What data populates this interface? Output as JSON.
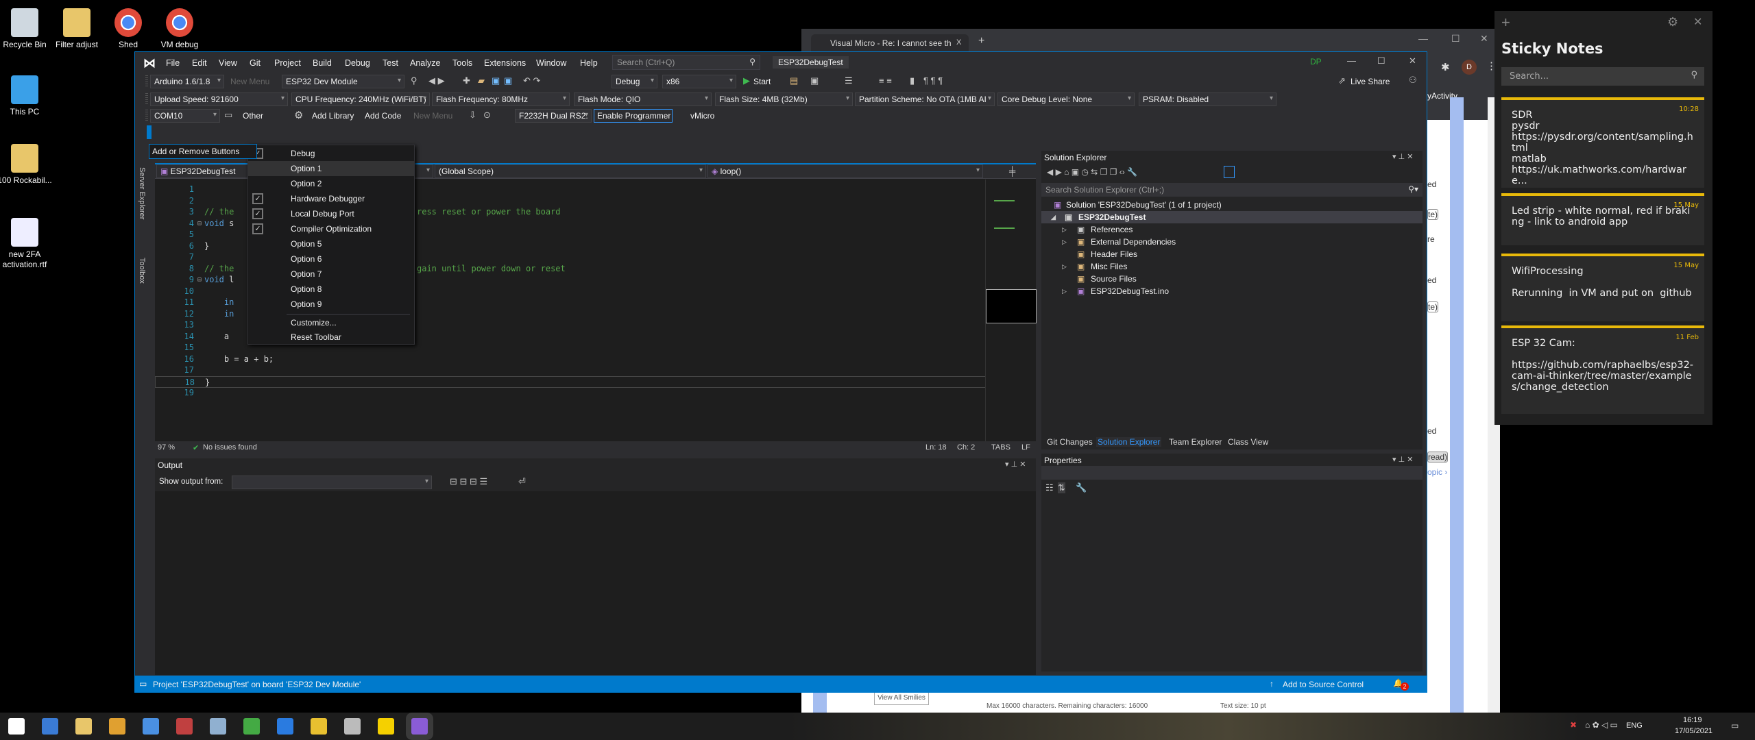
{
  "desktop": {
    "icons": [
      {
        "label": "Recycle Bin",
        "icon": "recycle-bin-icon"
      },
      {
        "label": "Filter adjust",
        "icon": "folder-icon"
      },
      {
        "label": "Shed",
        "icon": "chrome-icon"
      },
      {
        "label": "VM debug",
        "icon": "chrome-icon"
      },
      {
        "label": "This PC",
        "icon": "computer-icon"
      },
      {
        "label": "100 Rockabil...",
        "icon": "folder-icon"
      },
      {
        "label": "new 2FA activation.rtf",
        "icon": "document-icon"
      }
    ]
  },
  "browser": {
    "tab_title": "Visual Micro - Re: I cannot see th",
    "close": "X",
    "new_tab": "+",
    "avatar": "D",
    "page_fragments": [
      "yActivity",
      "ed",
      "te)",
      "re",
      "ed",
      "te)",
      "ed",
      "read)",
      "opic ›"
    ],
    "view_smilies": "View All Smilies",
    "max_chars": "Max 16000 characters. Remaining characters: 16000",
    "text_size": "Text size: 10 pt"
  },
  "vs": {
    "title": "ESP32DebugTest",
    "user_badge": "DP",
    "menu": [
      "File",
      "Edit",
      "View",
      "Git",
      "Project",
      "Build",
      "Debug",
      "Test",
      "Analyze",
      "Tools",
      "Extensions",
      "Window",
      "Help"
    ],
    "search_placeholder": "Search (Ctrl+Q)",
    "toolbar1": {
      "platform": "Arduino 1.6/1.8",
      "new_menu": "New Menu",
      "board": "ESP32 Dev Module",
      "config": "Debug",
      "arch": "x86",
      "start": "Start",
      "live_share": "Live Share"
    },
    "toolbar2": {
      "upload_speed": "Upload Speed: 921600",
      "cpu_freq": "CPU Frequency: 240MHz (WiFi/BT)",
      "flash_freq": "Flash Frequency: 80MHz",
      "flash_mode": "Flash Mode: QIO",
      "flash_size": "Flash Size: 4MB (32Mb)",
      "partition": "Partition Scheme: No OTA (1MB AI",
      "core_debug": "Core Debug Level: None",
      "psram": "PSRAM: Disabled"
    },
    "toolbar3": {
      "port": "COM10",
      "other": "Other",
      "add_library": "Add Library",
      "add_code": "Add Code",
      "new_menu": "New Menu",
      "programmer": "F2232H Dual RS2:",
      "enable_programmer": "Enable Programmer",
      "vmicro": "vMicro"
    },
    "add_remove_buttons": "Add or Remove Buttons",
    "dropdown": {
      "items": [
        {
          "label": "Debug",
          "checked": true
        },
        {
          "label": "Option 1",
          "checked": false,
          "hover": true
        },
        {
          "label": "Option 2",
          "checked": false
        },
        {
          "label": "Hardware Debugger",
          "checked": true
        },
        {
          "label": "Local Debug Port",
          "checked": true
        },
        {
          "label": "Compiler Optimization",
          "checked": true
        },
        {
          "label": "Option 5",
          "checked": false
        },
        {
          "label": "Option 6",
          "checked": false
        },
        {
          "label": "Option 7",
          "checked": false
        },
        {
          "label": "Option 8",
          "checked": false
        },
        {
          "label": "Option 9",
          "checked": false
        }
      ],
      "customize": "Customize...",
      "reset": "Reset Toolbar"
    },
    "side_tabs": [
      "Server Explorer",
      "Toolbox"
    ],
    "editor": {
      "nav": {
        "project": "ESP32DebugTest",
        "scope": "(Global Scope)",
        "member": "loop()"
      },
      "lines": [
        {
          "n": "1",
          "parts": []
        },
        {
          "n": "2",
          "parts": []
        },
        {
          "n": "3",
          "parts": [
            {
              "t": "// the",
              "c": "cc"
            }
          ],
          "tail": "ress reset or power the board"
        },
        {
          "n": "4",
          "parts": [
            {
              "t": "void",
              "c": "ck"
            },
            {
              "t": " s",
              "c": "cp"
            }
          ],
          "fold": true
        },
        {
          "n": "5",
          "parts": []
        },
        {
          "n": "6",
          "parts": [
            {
              "t": "}",
              "c": "cp"
            }
          ]
        },
        {
          "n": "7",
          "parts": []
        },
        {
          "n": "8",
          "parts": [
            {
              "t": "// the",
              "c": "cc"
            }
          ],
          "tail": "gain until power down or reset"
        },
        {
          "n": "9",
          "parts": [
            {
              "t": "void",
              "c": "ck"
            },
            {
              "t": " l",
              "c": "cp"
            }
          ],
          "fold": true
        },
        {
          "n": "10",
          "parts": []
        },
        {
          "n": "11",
          "parts": [
            {
              "t": "    in",
              "c": "ck"
            }
          ]
        },
        {
          "n": "12",
          "parts": [
            {
              "t": "    in",
              "c": "ck"
            }
          ]
        },
        {
          "n": "13",
          "parts": []
        },
        {
          "n": "14",
          "parts": [
            {
              "t": "    a",
              "c": "cp"
            }
          ]
        },
        {
          "n": "15",
          "parts": []
        },
        {
          "n": "16",
          "parts": [
            {
              "t": "    b = a + b;",
              "c": "cp"
            }
          ]
        },
        {
          "n": "17",
          "parts": []
        },
        {
          "n": "18",
          "parts": [
            {
              "t": "}",
              "c": "cp"
            }
          ],
          "current": true
        },
        {
          "n": "19",
          "parts": []
        }
      ],
      "zoom": "97 %",
      "issues": "No issues found",
      "ln": "Ln: 18",
      "ch": "Ch: 2",
      "tabs": "TABS",
      "eol": "LF"
    },
    "output": {
      "title": "Output",
      "show_from": "Show output from:"
    },
    "solution_explorer": {
      "title": "Solution Explorer",
      "search_placeholder": "Search Solution Explorer (Ctrl+;)",
      "tree": [
        {
          "label": "Solution 'ESP32DebugTest' (1 of 1 project)",
          "level": 0,
          "icon": "solution-icon"
        },
        {
          "label": "ESP32DebugTest",
          "level": 1,
          "expanded": true,
          "bold": true,
          "icon": "project-icon"
        },
        {
          "label": "References",
          "level": 2,
          "expander": true,
          "icon": "references-icon"
        },
        {
          "label": "External Dependencies",
          "level": 2,
          "expander": true,
          "icon": "folder-icon"
        },
        {
          "label": "Header Files",
          "level": 2,
          "icon": "filter-folder-icon"
        },
        {
          "label": "Misc Files",
          "level": 2,
          "expander": true,
          "icon": "filter-folder-icon"
        },
        {
          "label": "Source Files",
          "level": 2,
          "icon": "filter-folder-icon"
        },
        {
          "label": "ESP32DebugTest.ino",
          "level": 2,
          "expander": true,
          "icon": "cpp-file-icon"
        }
      ],
      "tabs": [
        {
          "label": "Git Changes"
        },
        {
          "label": "Solution Explorer",
          "active": true
        },
        {
          "label": "Team Explorer"
        },
        {
          "label": "Class View"
        }
      ]
    },
    "properties": {
      "title": "Properties"
    },
    "status": {
      "message": "Project 'ESP32DebugTest' on board 'ESP32 Dev Module'",
      "source_control": "Add to Source Control",
      "notifications": "2"
    },
    "accent": "#007acc"
  },
  "sticky": {
    "title": "Sticky Notes",
    "search_placeholder": "Search...",
    "accent": "#e8b90a",
    "notes": [
      {
        "date": "10:28",
        "text": "SDR\npysdr\nhttps://pysdr.org/content/sampling.html\nmatlab\nhttps://uk.mathworks.com/hardware..."
      },
      {
        "date": "15 May",
        "text": "Led strip - white normal, red if braking - link to android app"
      },
      {
        "date": "15 May",
        "text": "WifiProcessing\n\nRerunning  in VM and put on  github"
      },
      {
        "date": "11 Feb",
        "text": "ESP 32 Cam:\n\nhttps://github.com/raphaelbs/esp32-cam-ai-thinker/tree/master/examples/change_detection"
      }
    ]
  },
  "taskbar": {
    "apps": [
      "start-icon",
      "network-app-icon",
      "file-explorer-icon",
      "chrome-icon",
      "media-player-icon",
      "paint-icon",
      "notepad-icon",
      "phone-icon",
      "vscode-icon",
      "radiation-app-icon",
      "tools-icon",
      "sticky-notes-icon",
      "visual-studio-icon"
    ],
    "lang": "ENG",
    "time": "16:19",
    "date": "17/05/2021"
  }
}
